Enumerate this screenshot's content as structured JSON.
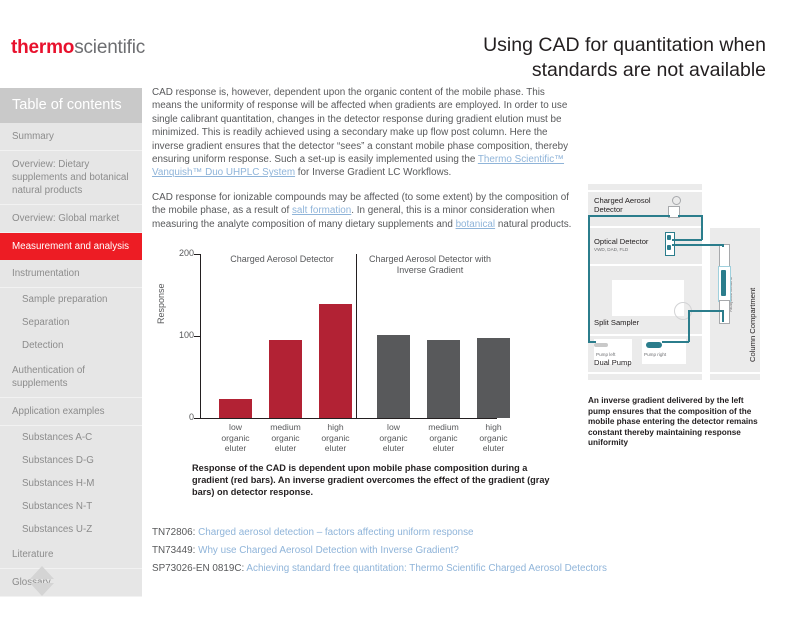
{
  "brand": {
    "logo_part1": "thermo",
    "logo_part2": "scientific",
    "accent_red": "#ED1C24",
    "logo_red": "#E8112D",
    "bar_red": "#B22234",
    "bar_gray": "#58595B",
    "link_blue": "#8FB4D9"
  },
  "header": {
    "title_line1": "Using CAD for quantitation when",
    "title_line2": "standards are not available"
  },
  "sidebar": {
    "header": "Table of contents",
    "items": [
      {
        "label": "Summary",
        "level": "top",
        "active": false
      },
      {
        "label": "Overview: Dietary supplements and botanical natural products",
        "level": "top",
        "active": false
      },
      {
        "label": "Overview: Global market",
        "level": "top",
        "active": false
      },
      {
        "label": "Measurement and analysis",
        "level": "top",
        "active": true
      },
      {
        "label": "Instrumentation",
        "level": "top",
        "active": false
      },
      {
        "label": "Sample preparation",
        "level": "sub",
        "active": false
      },
      {
        "label": "Separation",
        "level": "sub",
        "active": false
      },
      {
        "label": "Detection",
        "level": "sub",
        "active": false
      },
      {
        "label": "Authentication of supplements",
        "level": "top",
        "active": false
      },
      {
        "label": "Application examples",
        "level": "top",
        "active": false
      },
      {
        "label": "Substances A-C",
        "level": "sub",
        "active": false
      },
      {
        "label": "Substances D-G",
        "level": "sub",
        "active": false
      },
      {
        "label": "Substances H-M",
        "level": "sub",
        "active": false
      },
      {
        "label": "Substances N-T",
        "level": "sub",
        "active": false
      },
      {
        "label": "Substances U-Z",
        "level": "sub",
        "active": false
      },
      {
        "label": "Literature",
        "level": "top",
        "active": false
      },
      {
        "label": "Glossary",
        "level": "top",
        "active": false
      }
    ],
    "scroll_up_icon": "triangle-up-icon",
    "scroll_down_icon": "triangle-down-icon"
  },
  "body": {
    "paragraph1_a": "CAD response is, however, dependent upon the organic content of the mobile phase. This means the uniformity of response will be affected when gradients are employed. In order to use single calibrant quantitation, changes in the detector response during gradient elution must be minimized. This is readily achieved using a secondary make up flow post column. Here the inverse gradient ensures that the detector “sees” a constant mobile phase composition, thereby ensuring uniform response. Such a set-up is easily implemented using the ",
    "paragraph1_link": "Thermo Scientific™ Vanquish™ Duo UHPLC  System",
    "paragraph1_b": " for Inverse Gradient LC Workflows.",
    "paragraph2_a": "CAD response for ionizable compounds may be affected (to some extent) by the composition of the mobile phase, as a result of ",
    "paragraph2_link1": "salt formation",
    "paragraph2_b": ". In general, this is a minor consideration when measuring the analyte composition of many dietary supplements and ",
    "paragraph2_link2": "botanical",
    "paragraph2_c": " natural products."
  },
  "chart_data": {
    "type": "bar",
    "title": "",
    "xlabel": "",
    "ylabel": "Response",
    "ylim": [
      0,
      200
    ],
    "yticks": [
      0,
      100,
      200
    ],
    "grid": false,
    "legend_position": "none",
    "panels": [
      {
        "panel_title": "Charged Aerosol Detector",
        "color": "#B22234",
        "categories": [
          "low organic eluter",
          "medium organic eluter",
          "high organic eluter"
        ],
        "values": [
          23,
          95,
          139
        ]
      },
      {
        "panel_title": "Charged Aerosol Detector with Inverse Gradient",
        "color": "#58595B",
        "categories": [
          "low organic eluter",
          "medium organic eluter",
          "high organic eluter"
        ],
        "values": [
          101,
          95,
          98
        ]
      }
    ],
    "category_lines": [
      [
        "low",
        "organic",
        "eluter"
      ],
      [
        "medium",
        "organic",
        "eluter"
      ],
      [
        "high",
        "organic",
        "eluter"
      ]
    ],
    "caption": "Response of the CAD is dependent upon mobile phase composition during a gradient (red bars). An inverse gradient overcomes the effect of the gradient (gray bars) on detector response."
  },
  "diagram": {
    "modules": {
      "charged_aerosol_detector": "Charged Aerosol Detector",
      "optical_detector": "Optical Detector",
      "optical_detector_sub": "VWD, DAD, FLD",
      "split_sampler": "Split Sampler",
      "dual_pump": "Dual Pump",
      "pump_left": "Pump left",
      "pump_right": "Pump right",
      "column_compartment": "Column Compartment",
      "analytical_column": "Analytical Column"
    },
    "caption": "An inverse gradient delivered by the left pump ensures that the composition of the mobile phase entering the detector remains constant thereby maintaining response uniformity"
  },
  "references": [
    {
      "code": "TN72806:",
      "text": " Charged aerosol detection – factors affecting uniform response"
    },
    {
      "code": "TN73449:",
      "text": " Why use Charged Aerosol Detection with Inverse Gradient?"
    },
    {
      "code": "SP73026-EN 0819C:",
      "text": " Achieving standard free quantitation: Thermo Scientific Charged Aerosol Detectors"
    }
  ]
}
